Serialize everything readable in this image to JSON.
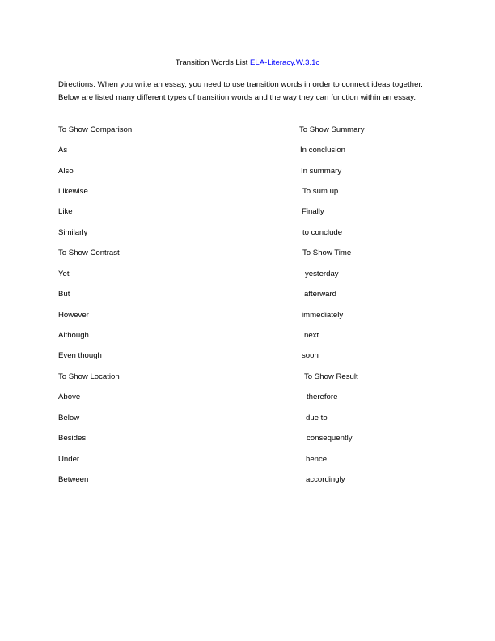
{
  "document": {
    "title_text": "Transition Words List",
    "title_link": "ELA-Literacy.W.3.1c",
    "directions": "Directions: When you write an essay, you need to use transition words in order to connect ideas together. Below are listed many different types of transition words and the way they can function within an essay."
  },
  "left_column": [
    "To Show Comparison",
    "As",
    "Also",
    "Likewise",
    "Like",
    "Similarly",
    "To Show Contrast",
    "Yet",
    "But",
    "However",
    "Although",
    "Even though",
    "To Show Location",
    "Above",
    "Below",
    "Besides",
    "Under",
    "Between"
  ],
  "right_column": [
    "To Show Summary",
    "In conclusion",
    "In summary",
    "To sum up",
    "Finally",
    "to conclude",
    "To Show Time",
    "yesterday",
    "afterward",
    "immediately",
    "next",
    "soon",
    "To Show Result",
    "therefore",
    "due to",
    "consequently",
    "hence",
    "accordingly"
  ],
  "colors": {
    "link": "#0000ff",
    "text": "#000000",
    "background": "#ffffff"
  }
}
